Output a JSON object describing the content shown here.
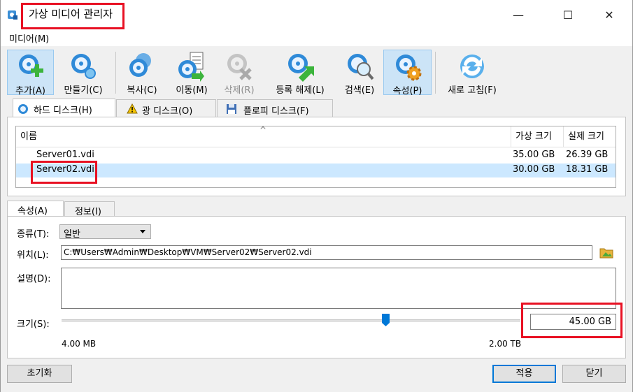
{
  "window": {
    "title": "가상 미디어 관리자",
    "minimize_glyph": "—",
    "maximize_glyph": "☐",
    "close_glyph": "✕"
  },
  "menubar": {
    "media": "미디어(M)"
  },
  "toolbar": {
    "add": "추가(A)",
    "create": "만들기(C)",
    "copy": "복사(C)",
    "move": "이동(M)",
    "remove": "삭제(R)",
    "release": "등록 해제(L)",
    "search": "검색(E)",
    "properties": "속성(P)",
    "refresh": "새로 고침(F)"
  },
  "media_tabs": {
    "hard_disk": "하드 디스크(H)",
    "optical_disk": "광 디스크(O)",
    "floppy_disk": "플로피 디스크(F)"
  },
  "table": {
    "columns": [
      "이름",
      "가상 크기",
      "실제 크기"
    ],
    "rows": [
      {
        "name": "Server01.vdi",
        "virtual_size": "35.00 GB",
        "actual_size": "26.39 GB",
        "selected": false
      },
      {
        "name": "Server02.vdi",
        "virtual_size": "30.00 GB",
        "actual_size": "18.31 GB",
        "selected": true
      }
    ]
  },
  "detail_tabs": {
    "attributes": "속성(A)",
    "information": "정보(I)"
  },
  "form": {
    "type_label": "종류(T):",
    "type_value": "일반",
    "location_label": "위치(L):",
    "location_value": "C:₩Users₩Admin₩Desktop₩VM₩Server02₩Server02.vdi",
    "description_label": "설명(D):",
    "description_value": "",
    "size_label": "크기(S):",
    "size_value": "45.00 GB",
    "slider_min": "4.00 MB",
    "slider_max": "2.00 TB"
  },
  "buttons": {
    "reset": "초기화",
    "apply": "적용",
    "close": "닫기"
  },
  "colors": {
    "highlight_box": "#e81123",
    "selection": "#cce8ff",
    "accent": "#0078d7"
  }
}
